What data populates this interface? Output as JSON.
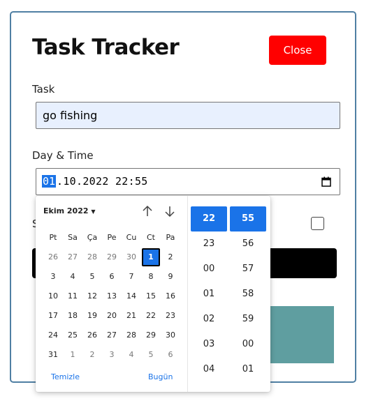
{
  "app": {
    "title": "Task Tracker",
    "close_label": "Close"
  },
  "form": {
    "task_label": "Task",
    "task_value": "go fishing",
    "daytime_label": "Day & Time",
    "dt_day": "01",
    "dt_rest": ".10.2022 22:55",
    "reminder_partial": "S"
  },
  "picker": {
    "month": "Ekim 2022",
    "weekdays": [
      "Pt",
      "Sa",
      "Ça",
      "Pe",
      "Cu",
      "Ct",
      "Pa"
    ],
    "days": [
      [
        "26",
        "27",
        "28",
        "29",
        "30",
        "1",
        "2"
      ],
      [
        "3",
        "4",
        "5",
        "6",
        "7",
        "8",
        "9"
      ],
      [
        "10",
        "11",
        "12",
        "13",
        "14",
        "15",
        "16"
      ],
      [
        "17",
        "18",
        "19",
        "20",
        "21",
        "22",
        "23"
      ],
      [
        "24",
        "25",
        "26",
        "27",
        "28",
        "29",
        "30"
      ],
      [
        "31",
        "1",
        "2",
        "3",
        "4",
        "5",
        "6"
      ]
    ],
    "clear_label": "Temizle",
    "today_label": "Bugün",
    "hours": [
      "22",
      "23",
      "00",
      "01",
      "02",
      "03",
      "04"
    ],
    "minutes": [
      "55",
      "56",
      "57",
      "58",
      "59",
      "00",
      "01"
    ]
  },
  "colors": {
    "accent": "#1a73e8",
    "close": "#ff0000",
    "teal": "#5f9ea0"
  }
}
